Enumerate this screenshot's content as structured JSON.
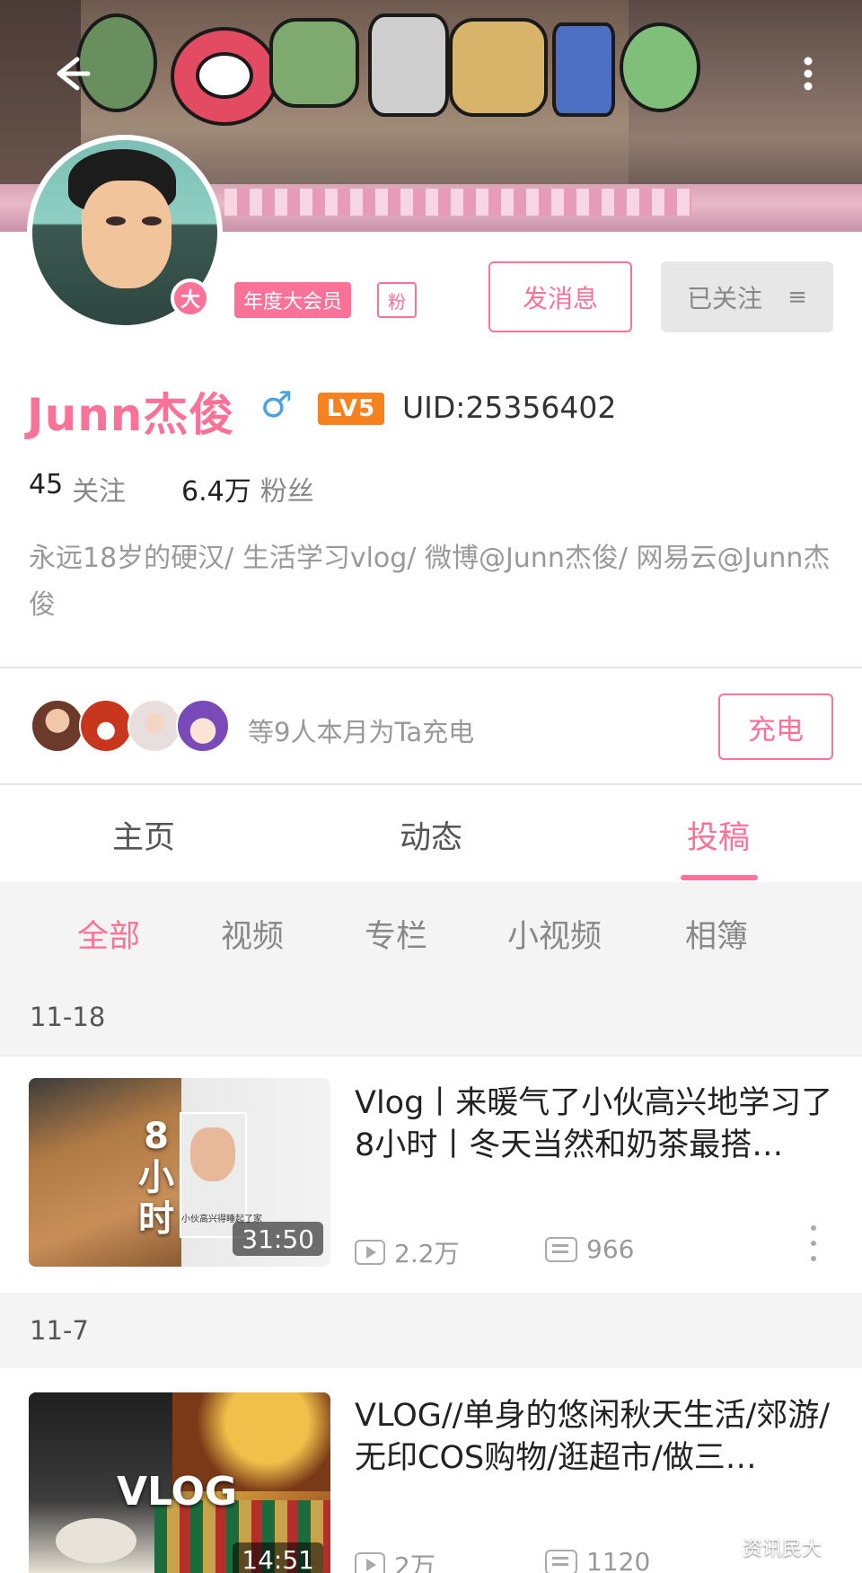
{
  "colors": {
    "accent": "#fb7299",
    "level": "#f7811e",
    "gender": "#4aa3df"
  },
  "header": {
    "back_icon": "arrow-left-icon",
    "more_icon": "more-vertical-icon"
  },
  "profile": {
    "vip_badge": "大",
    "vip_tag": "年度大会员",
    "fan_tag": "粉",
    "message_button": "发消息",
    "followed_button": "已关注",
    "followed_menu_icon": "≡",
    "name": "Junn杰俊",
    "gender": "♂",
    "level": "LV5",
    "uid": "UID:25356402",
    "following_count": "45",
    "following_label": "关注",
    "followers_count": "6.4万",
    "followers_label": "粉丝",
    "bio": "永远18岁的硬汉/ 生活学习vlog/ 微博@Junn杰俊/ 网易云@Junn杰俊"
  },
  "charge": {
    "text": "等9人本月为Ta充电",
    "button": "充电"
  },
  "tabs": [
    {
      "label": "主页"
    },
    {
      "label": "动态"
    },
    {
      "label": "投稿"
    }
  ],
  "subtabs": [
    {
      "label": "全部"
    },
    {
      "label": "视频"
    },
    {
      "label": "专栏"
    },
    {
      "label": "小视频"
    },
    {
      "label": "相簿"
    }
  ],
  "videos": [
    {
      "date": "11-18",
      "title": "Vlog丨来暖气了小伙高兴地学习了8小时丨冬天当然和奶茶最搭…",
      "thumb_text": "8\n小\n时",
      "thumb_caption": "小伙高兴得睡起了家",
      "duration": "31:50",
      "views": "2.2万",
      "danmaku": "966"
    },
    {
      "date": "11-7",
      "title": "VLOG//单身的悠闲秋天生活/郊游/无印COS购物/逛超市/做三…",
      "thumb_text": "VLOG",
      "duration": "14:51",
      "views": "2万",
      "danmaku": "1120"
    }
  ],
  "watermark": "资讯民大"
}
